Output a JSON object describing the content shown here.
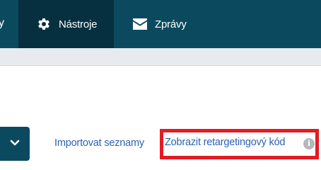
{
  "nav": {
    "partial_label": "y",
    "tools_label": "Nástroje",
    "messages_label": "Zprávy"
  },
  "actions": {
    "import_label": "Importovat seznamy",
    "retarget_label": "Zobrazit retargetingový kód",
    "info_icon_glyph": "i"
  },
  "colors": {
    "nav_bg": "#0b4a5e",
    "nav_active_bg": "#06303f",
    "link": "#2b62b3",
    "highlight": "#e31b23"
  },
  "icons": {
    "tools": "gear-icon",
    "messages": "envelope-icon",
    "dropdown": "chevron-down-icon",
    "info": "info-icon"
  }
}
